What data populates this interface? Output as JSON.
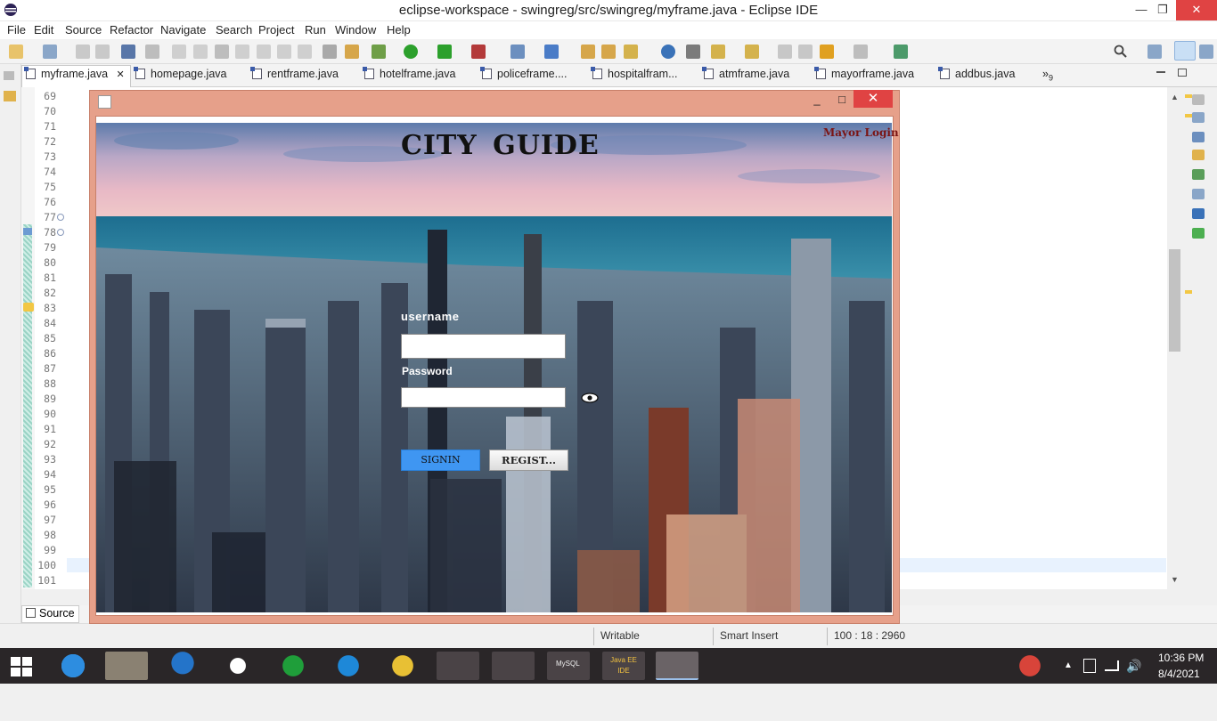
{
  "window": {
    "title": "eclipse-workspace - swingreg/src/swingreg/myframe.java - Eclipse IDE",
    "minimize": "—",
    "maximize": "❐",
    "close": "✕"
  },
  "menu": [
    "File",
    "Edit",
    "Source",
    "Refactor",
    "Navigate",
    "Search",
    "Project",
    "Run",
    "Window",
    "Help"
  ],
  "tabs": [
    "myframe.java",
    "homepage.java",
    "rentframe.java",
    "hotelframe.java",
    "policeframe....",
    "hospitalfram...",
    "atmframe.java",
    "mayorframe.java",
    "addbus.java"
  ],
  "tab_close": "✕",
  "tab_overflow": "»",
  "tab_overflow_count": "9",
  "line_numbers": [
    "69",
    "70",
    "71",
    "72",
    "73",
    "74",
    "75",
    "76",
    "77",
    "78",
    "79",
    "80",
    "81",
    "82",
    "83",
    "84",
    "85",
    "86",
    "87",
    "88",
    "89",
    "90",
    "91",
    "92",
    "93",
    "94",
    "95",
    "96",
    "97",
    "98",
    "99",
    "100",
    "101"
  ],
  "bottom_tab": "Source",
  "status": {
    "writable": "Writable",
    "insert": "Smart Insert",
    "position": "100 : 18 : 2960"
  },
  "app": {
    "title": "CITY  GUIDE",
    "mayor_login": "Mayor Login",
    "username_label": "username",
    "password_label": "Password",
    "username_value": "",
    "password_value": "",
    "signin": "SIGNIN",
    "register": "REGIST..."
  },
  "clock": {
    "time": "10:36 PM",
    "date": "8/4/2021"
  },
  "taskbar_labels": {
    "mysql": "MySQL",
    "javaee": "Java EE IDE"
  },
  "colors": {
    "frame_border": "#e6a08a",
    "close_red": "#e04343",
    "signin_blue": "#3f96f2",
    "taskbar": "#2a2628"
  }
}
